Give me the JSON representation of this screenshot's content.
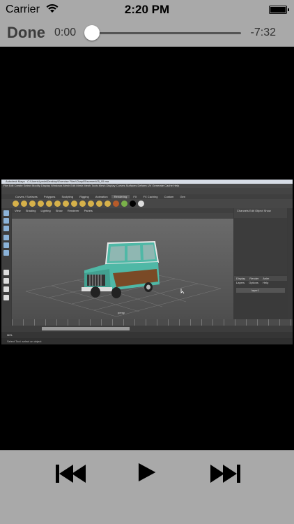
{
  "status_bar": {
    "carrier": "Carrier",
    "time": "2:20 PM"
  },
  "player": {
    "done_label": "Done",
    "elapsed": "0:00",
    "remaining": "-7:32",
    "progress": 0.0
  },
  "video": {
    "window_title": "Autodesk Maya · C:\\Users\\Lynda\\Desktop\\Exercise Files\\Chap05\\scenes\\05_05.ma",
    "menu_items": [
      "File",
      "Edit",
      "Create",
      "Select",
      "Modify",
      "Display",
      "Windows",
      "Mesh",
      "Edit Mesh",
      "Mesh Tools",
      "Mesh Display",
      "Curves",
      "Surfaces",
      "Deform",
      "UV",
      "Generate",
      "Cache",
      "Help"
    ],
    "shelf_tabs": [
      "Curves / Surfaces",
      "Polygons",
      "Sculpting",
      "Rigging",
      "Animation",
      "Rendering",
      "FX",
      "FX Caching",
      "Custom",
      "Gen"
    ],
    "active_shelf_tab": "Rendering",
    "viewport_menu": [
      "View",
      "Shading",
      "Lighting",
      "Show",
      "Renderer",
      "Panels"
    ],
    "camera_label": "persp",
    "channel_box_tabs": [
      "Channels",
      "Edit",
      "Object",
      "Show"
    ],
    "layer_tabs": [
      "Display",
      "Render",
      "Anim"
    ],
    "layer_menu": [
      "Layers",
      "Options",
      "Help"
    ],
    "layer_name": "layer1",
    "help_text": "Select Tool: select an object",
    "cmd_label": "MEL"
  },
  "icons": {
    "wifi": "wifi-icon",
    "battery": "battery-icon",
    "rewind": "skip-back-icon",
    "play": "play-icon",
    "ffwd": "skip-forward-icon"
  },
  "colors": {
    "chrome": "#a9a9a9",
    "controls": "#000000",
    "car_body": "#4fb8a6",
    "car_wood": "#7a4a26"
  }
}
